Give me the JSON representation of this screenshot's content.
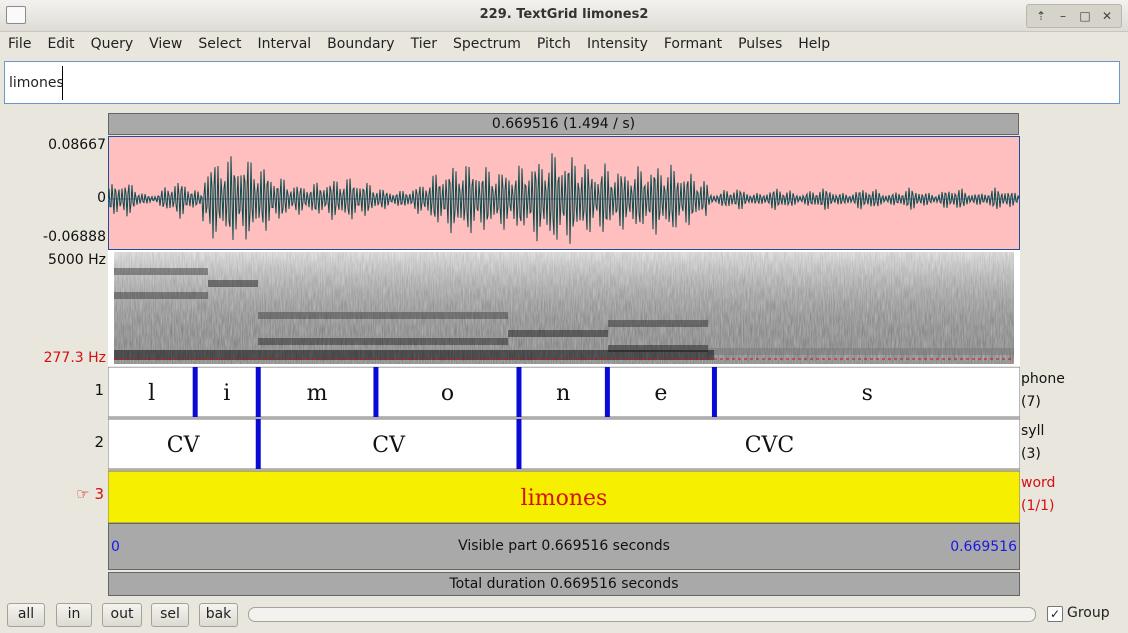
{
  "window": {
    "title": "229. TextGrid limones2"
  },
  "menu": [
    "File",
    "Edit",
    "Query",
    "View",
    "Select",
    "Interval",
    "Boundary",
    "Tier",
    "Spectrum",
    "Pitch",
    "Intensity",
    "Formant",
    "Pulses",
    "Help"
  ],
  "text_field": {
    "value": "limones"
  },
  "selection_bar": "0.669516 (1.494 / s)",
  "waveform": {
    "ymax": "0.08667",
    "zero": "0",
    "ymin": "-0.06888"
  },
  "spectrogram": {
    "top_label": "5000 Hz",
    "pitch_label": "277.3 Hz"
  },
  "tiers": [
    {
      "number": "1",
      "name": "phone",
      "count": "(7)",
      "intervals": [
        {
          "label": "l",
          "start": 0,
          "end": 0.064
        },
        {
          "label": "i",
          "start": 0.064,
          "end": 0.1103
        },
        {
          "label": "m",
          "start": 0.1103,
          "end": 0.1967
        },
        {
          "label": "o",
          "start": 0.1967,
          "end": 0.3017
        },
        {
          "label": "n",
          "start": 0.3017,
          "end": 0.3666
        },
        {
          "label": "e",
          "start": 0.3666,
          "end": 0.4452
        },
        {
          "label": "s",
          "start": 0.4452,
          "end": 0.669516
        }
      ]
    },
    {
      "number": "2",
      "name": "syll",
      "count": "(3)",
      "intervals": [
        {
          "label": "CV",
          "start": 0,
          "end": 0.1103
        },
        {
          "label": "CV",
          "start": 0.1103,
          "end": 0.3017
        },
        {
          "label": "CVC",
          "start": 0.3017,
          "end": 0.669516
        }
      ]
    },
    {
      "number": "3",
      "name": "word",
      "count": "(1/1)",
      "selected": true,
      "pointer": "☞",
      "intervals": [
        {
          "label": "limones",
          "start": 0,
          "end": 0.669516
        }
      ]
    }
  ],
  "time": {
    "start": "0",
    "end": "0.669516",
    "total_seconds": 0.669516
  },
  "visible_part": "Visible part 0.669516 seconds",
  "total_duration": "Total duration 0.669516 seconds",
  "buttons": {
    "all": "all",
    "in": "in",
    "out": "out",
    "sel": "sel",
    "bak": "bak"
  },
  "group": {
    "label": "Group",
    "checked": true
  },
  "colors": {
    "wave_bg": "#ffbfbf",
    "wave_line": "#0d4a4a",
    "selected_tier": "#f7ef00",
    "boundary": "#0a0ad6",
    "accent_red": "#d41010",
    "time_blue": "#1a1ae0"
  }
}
